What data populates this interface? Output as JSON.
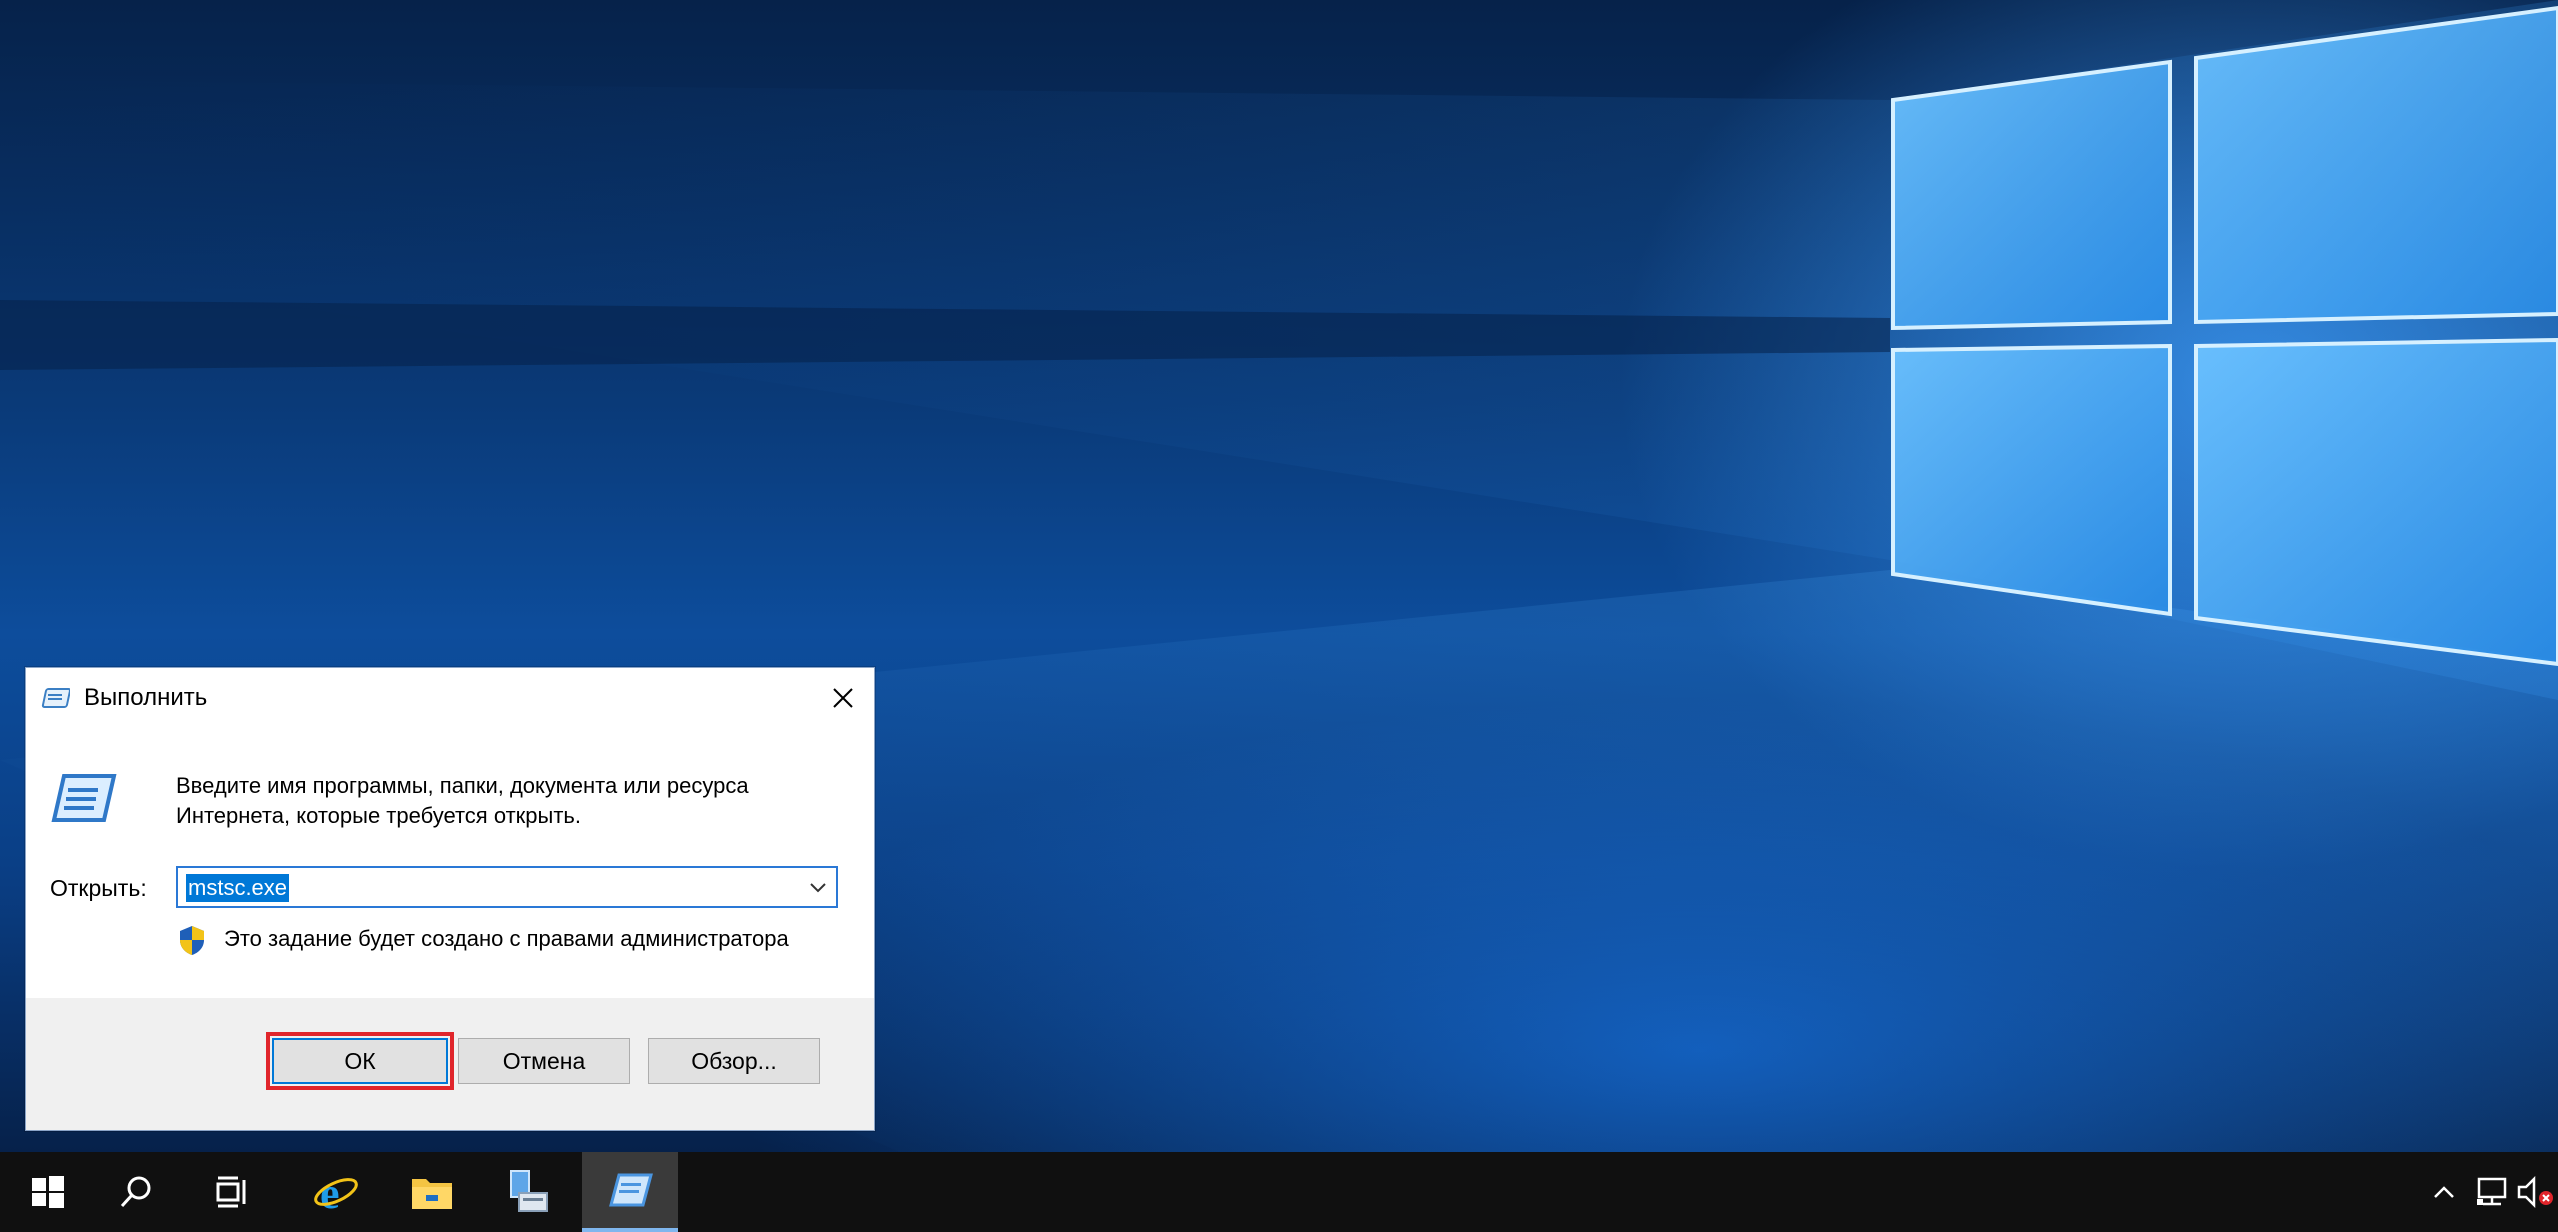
{
  "dialog": {
    "title": "Выполнить",
    "description": "Введите имя программы, папки, документа или ресурса Интернета, которые требуется открыть.",
    "open_label": "Открыть:",
    "open_value": "mstsc.exe",
    "admin_note": "Это задание будет создано с правами администратора",
    "buttons": {
      "ok": "ОК",
      "cancel": "Отмена",
      "browse": "Обзор..."
    }
  },
  "taskbar": {
    "items": [
      "start-icon",
      "search-icon",
      "task-view-icon",
      "internet-explorer-icon",
      "file-explorer-icon",
      "server-manager-icon",
      "run-icon"
    ],
    "active_item": "run-icon",
    "tray": [
      "show-hidden-icons-chevron",
      "network-icon",
      "volume-muted-icon"
    ]
  },
  "colors": {
    "accent": "#0078d7",
    "highlight_outline": "#e0252b",
    "taskbar": "#101010"
  }
}
